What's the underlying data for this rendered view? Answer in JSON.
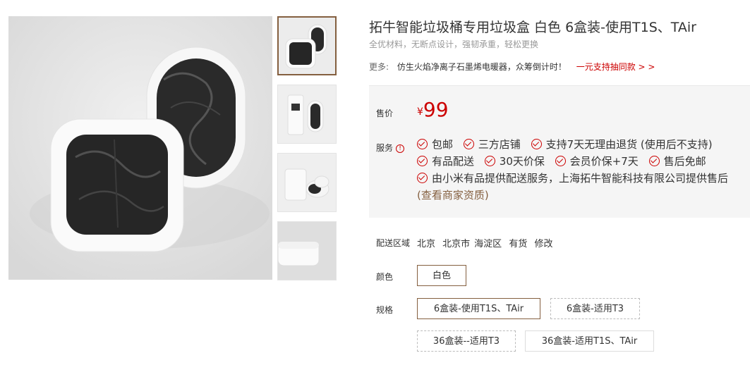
{
  "product": {
    "title": "拓牛智能垃圾桶专用垃圾盒 白色 6盒装-使用T1S、TAir",
    "subtitle": "全优材料，无断点设计，强韧承重，轻松更换"
  },
  "more": {
    "label": "更多:",
    "text": "仿生火焰净离子石墨烯电暖器，众筹倒计时！",
    "link": "一元支持抽同款 > >"
  },
  "price": {
    "label": "售价",
    "currency": "¥",
    "value": "99"
  },
  "services": {
    "label": "服务",
    "warn_icon": "!",
    "items": [
      "包邮",
      "三方店铺",
      "支持7天无理由退货 (使用后不支持)",
      "有品配送",
      "30天价保",
      "会员价保+7天",
      "售后免邮"
    ],
    "long_text": "由小米有品提供配送服务，上海拓牛智能科技有限公司提供售后",
    "long_link": "(查看商家资质)"
  },
  "delivery": {
    "label": "配送区域",
    "province": "北京",
    "city": "北京市",
    "district": "海淀区",
    "stock": "有货",
    "edit": "修改"
  },
  "color": {
    "label": "颜色",
    "options": [
      "白色"
    ],
    "selected": 0
  },
  "spec": {
    "label": "规格",
    "options": [
      "6盒装-使用T1S、TAir",
      "6盒装-适用T3",
      "36盒装--适用T3",
      "36盒装-适用T1S、TAir"
    ]
  },
  "colors": {
    "accent": "#c00",
    "brand": "#845f3f"
  }
}
